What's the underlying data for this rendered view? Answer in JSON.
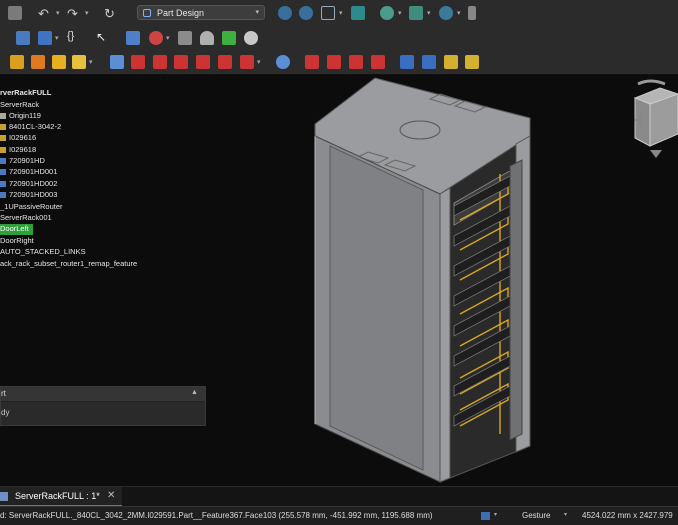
{
  "toolbar": {
    "workbench": "Part Design",
    "row1_icons": [
      "save-icon",
      "undo-icon",
      "redo-icon",
      "refresh-icon",
      "zoom-fit-icon",
      "zoom-selection-icon",
      "view-cube-icon",
      "measure-icon",
      "draw-style-icon",
      "selection-filter-icon",
      "zoom-icon",
      "clip-icon"
    ],
    "row2_icons": [
      "folder-icon",
      "export-icon",
      "macro-icon",
      "whats-this-icon",
      "body-icon",
      "sketch-icon",
      "attach-icon",
      "shape-binder-icon",
      "sub-shape-binder-icon",
      "clone-icon"
    ],
    "row3_icons": [
      "part-icon",
      "create-icon",
      "pad-icon",
      "revolution-icon",
      "loft-icon",
      "pipe-icon",
      "pocket-icon",
      "groove-icon",
      "subtractive-loft-icon",
      "subtractive-pipe-icon",
      "hole-icon",
      "pattern-icon",
      "fillet-icon",
      "chamfer-icon",
      "draft-icon",
      "thickness-icon",
      "assembly-icon",
      "fastener-icon",
      "screw-icon",
      "nut-icon"
    ]
  },
  "tree": {
    "items": [
      {
        "label": "rverRackFULL",
        "level": 0,
        "bold": true
      },
      {
        "label": "ServerRack",
        "level": 1
      },
      {
        "label": "Origin119",
        "level": 2
      },
      {
        "label": "8401CL-3042-2",
        "level": 2
      },
      {
        "label": "I029616",
        "level": 2
      },
      {
        "label": "I029618",
        "level": 2
      },
      {
        "label": "720901HD",
        "level": 2
      },
      {
        "label": "720901HD001",
        "level": 2
      },
      {
        "label": "720901HD002",
        "level": 2
      },
      {
        "label": "720901HD003",
        "level": 2
      },
      {
        "label": "_1UPassiveRouter",
        "level": 1
      },
      {
        "label": "ServerRack001",
        "level": 1
      },
      {
        "label": "DoorLeft",
        "level": 1,
        "selected": true
      },
      {
        "label": "DoorRight",
        "level": 1
      },
      {
        "label": "AUTO_STACKED_LINKS",
        "level": 1
      },
      {
        "label": "ack_rack_subset_router1_remap_feature",
        "level": 1
      }
    ]
  },
  "panel": {
    "title": "rt",
    "body": "dy"
  },
  "tab": {
    "label": "ServerRackFULL : 1*",
    "close": "✕"
  },
  "status": {
    "message": "d: ServerRackFULL._840CL_3042_2MM.I029591.Part__Feature367.Face103 (255.578 mm, -451.992 mm, 1195.688 mm)",
    "navigation": "Gesture",
    "dimensions": "4524.022 mm x 2427.979"
  },
  "colors": {
    "selection": "#2f9e3b",
    "tab_accent": "#3d7bd6",
    "rack_body": "#8a8c8f",
    "cable": "#e0b020"
  }
}
